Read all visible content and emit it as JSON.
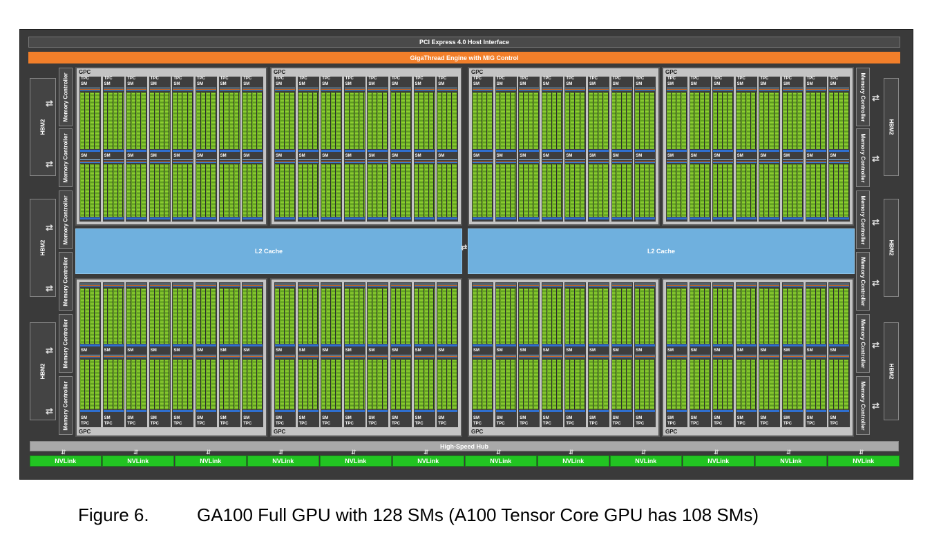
{
  "diagram": {
    "host_interface": "PCI Express 4.0 Host Interface",
    "engine": "GigaThread Engine with MIG Control",
    "l2_cache_label": "L2 Cache",
    "high_speed_hub": "High-Speed Hub",
    "nvlink_label": "NVLink",
    "nvlink_count": 12,
    "gpc_label": "GPC",
    "tpc_label": "TPC",
    "sm_label": "SM",
    "hbm_label": "HBM2",
    "memory_controller_label": "Memory Controller",
    "gpc_count": 8,
    "tpc_per_gpc": 8,
    "sm_per_tpc": 2,
    "colors": {
      "engine": "#f27f2a",
      "l2_cache": "#6fb0de",
      "nvlink": "#22c422",
      "hub": "#a9a9a9",
      "core_green": "#7fbf2a",
      "core_blue": "#2f6fcf",
      "core_orange": "#d06a2a"
    }
  },
  "caption": {
    "number": "Figure 6.",
    "text": "GA100 Full GPU with 128 SMs (A100 Tensor Core GPU has 108 SMs)"
  }
}
